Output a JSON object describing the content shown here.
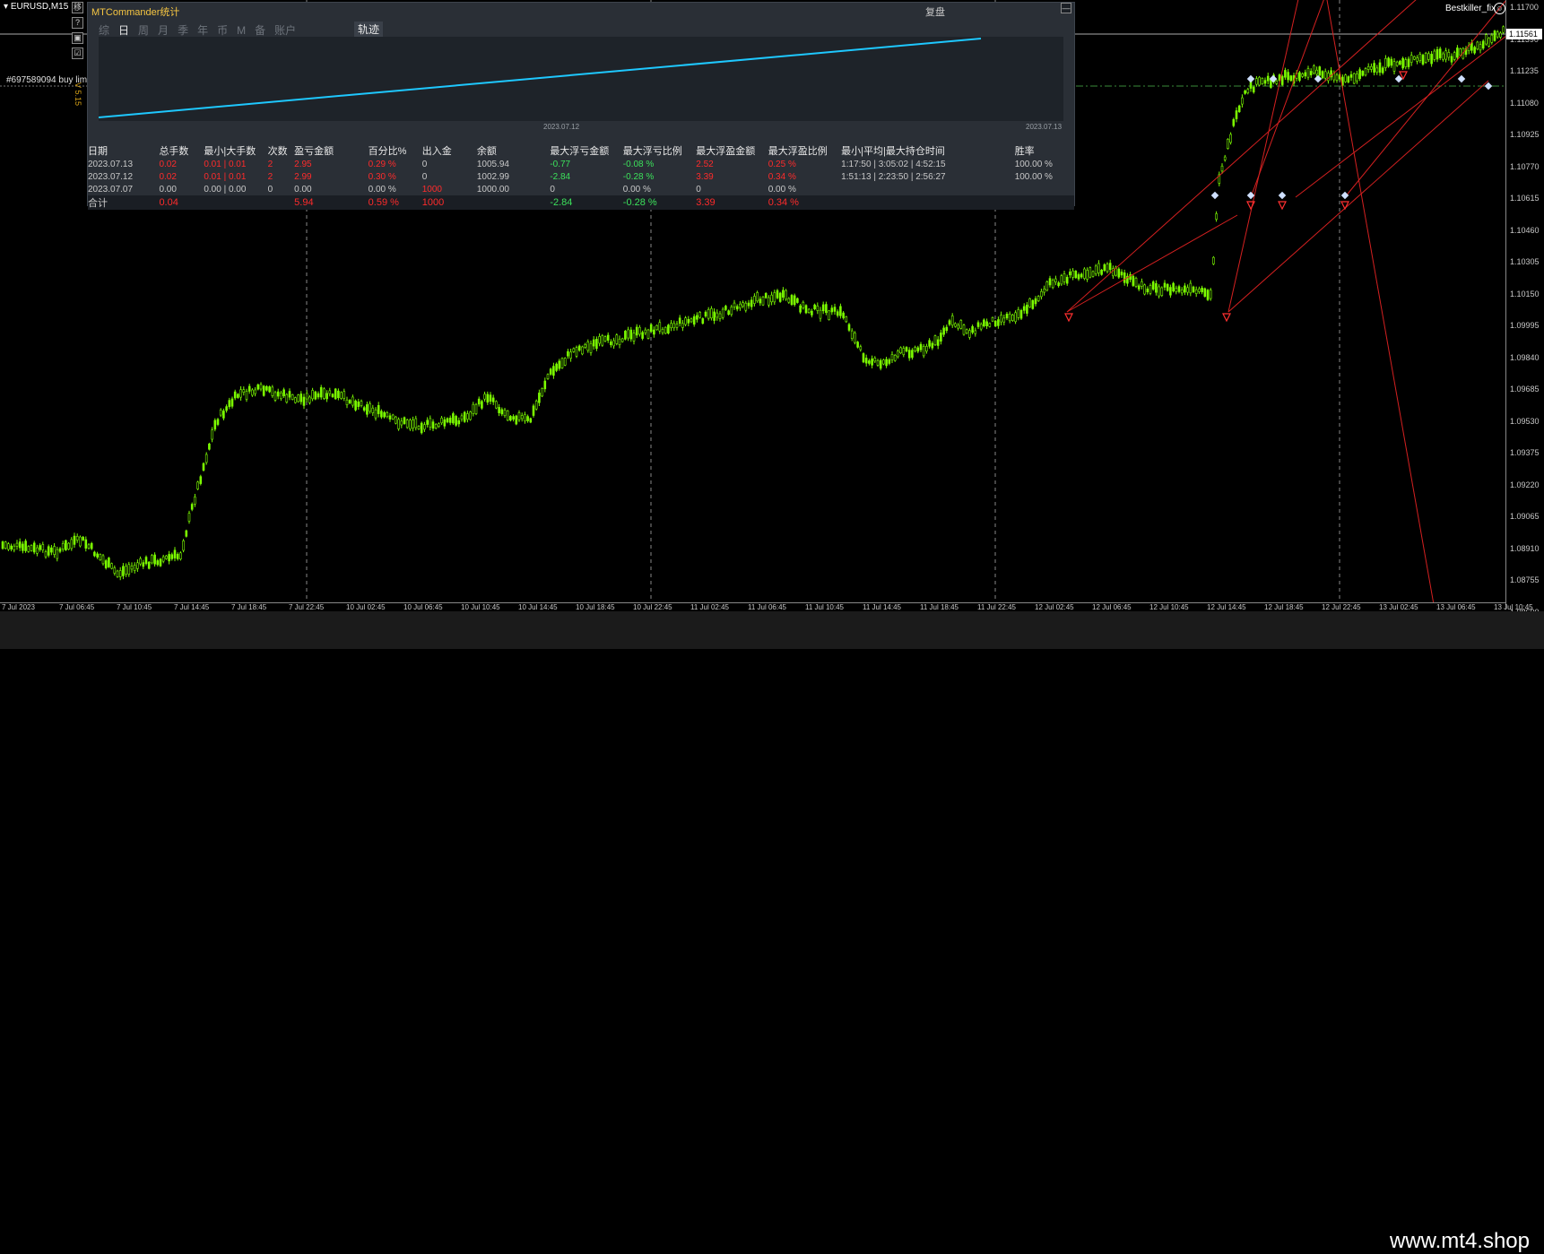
{
  "symbol": "EURUSD,M15",
  "side_buttons": [
    "移",
    "?",
    "▣",
    "☑"
  ],
  "order_label": "#697589094 buy limit",
  "ea_version": "V 5.15",
  "ea_name": "Bestkiller_fix",
  "current_price": "1.11561",
  "price_ticks": [
    "1.11700",
    "1.11390",
    "1.11235",
    "1.11080",
    "1.10925",
    "1.10770",
    "1.10615",
    "1.10460",
    "1.10305",
    "1.10150",
    "1.09995",
    "1.09840",
    "1.09685",
    "1.09530",
    "1.09375",
    "1.09220",
    "1.09065",
    "1.08910",
    "1.08755",
    "1.08600"
  ],
  "time_ticks": [
    "7 Jul 2023",
    "7 Jul 06:45",
    "7 Jul 10:45",
    "7 Jul 14:45",
    "7 Jul 18:45",
    "7 Jul 22:45",
    "10 Jul 02:45",
    "10 Jul 06:45",
    "10 Jul 10:45",
    "10 Jul 14:45",
    "10 Jul 18:45",
    "10 Jul 22:45",
    "11 Jul 02:45",
    "11 Jul 06:45",
    "11 Jul 10:45",
    "11 Jul 14:45",
    "11 Jul 18:45",
    "11 Jul 22:45",
    "12 Jul 02:45",
    "12 Jul 06:45",
    "12 Jul 10:45",
    "12 Jul 14:45",
    "12 Jul 18:45",
    "12 Jul 22:45",
    "13 Jul 02:45",
    "13 Jul 06:45",
    "13 Jul 10:45"
  ],
  "watermark": "www.mt4.shop",
  "panel": {
    "title": "MTCommander统计",
    "restore": "复盘",
    "minimize": "—",
    "tabs": [
      "综",
      "日",
      "周",
      "月",
      "季",
      "年",
      "币",
      "M",
      "备",
      "账户"
    ],
    "active_tab": "日",
    "trace_tab": "轨迹",
    "trace_dates": [
      "2023.07.12",
      "2023.07.13"
    ],
    "columns": [
      "日期",
      "总手数",
      "最小|大手数",
      "次数",
      "盈亏金额",
      "百分比%",
      "出入金",
      "余额",
      "最大浮亏金额",
      "最大浮亏比例",
      "最大浮盈金额",
      "最大浮盈比例",
      "最小|平均|最大持仓时间",
      "胜率"
    ],
    "rows": [
      [
        "2023.07.13",
        "0.02",
        "0.01 | 0.01",
        "2",
        "2.95",
        "0.29 %",
        "0",
        "1005.94",
        "-0.77",
        "-0.08 %",
        "2.52",
        "0.25 %",
        "1:17:50 | 3:05:02 | 4:52:15",
        "100.00 %"
      ],
      [
        "2023.07.12",
        "0.02",
        "0.01 | 0.01",
        "2",
        "2.99",
        "0.30 %",
        "0",
        "1002.99",
        "-2.84",
        "-0.28 %",
        "3.39",
        "0.34 %",
        "1:51:13 | 2:23:50 | 2:56:27",
        "100.00 %"
      ],
      [
        "2023.07.07",
        "0.00",
        "0.00 | 0.00",
        "0",
        "0.00",
        "0.00 %",
        "1000",
        "1000.00",
        "0",
        "0.00 %",
        "0",
        "0.00 %",
        "",
        ""
      ]
    ],
    "total": [
      "合计",
      "0.04",
      "",
      "",
      "5.94",
      "0.59 %",
      "1000",
      "",
      "-2.84",
      "-0.28 %",
      "3.39",
      "0.34 %",
      "",
      ""
    ]
  },
  "colors": {
    "candle": "#7cfc00",
    "trace": "#1ec8ff",
    "loss": "#ff2b2b",
    "gain": "#3ce15b"
  }
}
